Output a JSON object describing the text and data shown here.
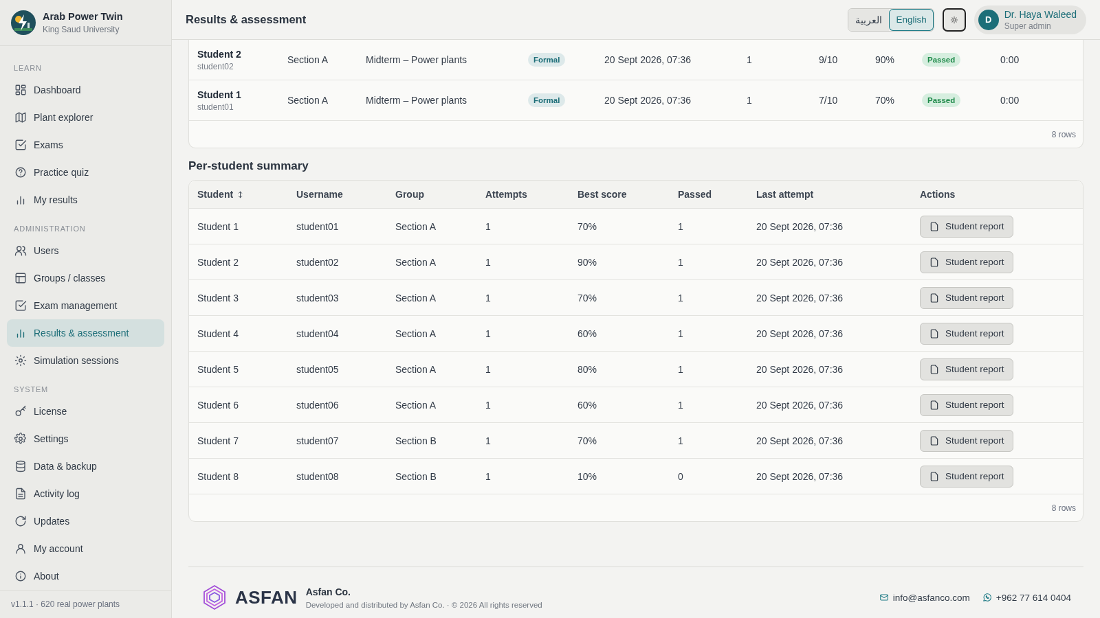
{
  "brand": {
    "title": "Arab Power Twin",
    "subtitle": "King Saud University"
  },
  "sidebar": {
    "sections": [
      {
        "label": "LEARN",
        "items": [
          {
            "label": "Dashboard",
            "selected": false
          },
          {
            "label": "Plant explorer",
            "selected": false
          },
          {
            "label": "Exams",
            "selected": false
          },
          {
            "label": "Practice quiz",
            "selected": false
          },
          {
            "label": "My results",
            "selected": false
          }
        ]
      },
      {
        "label": "ADMINISTRATION",
        "items": [
          {
            "label": "Users",
            "selected": false
          },
          {
            "label": "Groups / classes",
            "selected": false
          },
          {
            "label": "Exam management",
            "selected": false
          },
          {
            "label": "Results & assessment",
            "selected": true
          },
          {
            "label": "Simulation sessions",
            "selected": false
          }
        ]
      },
      {
        "label": "SYSTEM",
        "items": [
          {
            "label": "License",
            "selected": false
          },
          {
            "label": "Settings",
            "selected": false
          },
          {
            "label": "Data & backup",
            "selected": false
          },
          {
            "label": "Activity log",
            "selected": false
          },
          {
            "label": "Updates",
            "selected": false
          },
          {
            "label": "My account",
            "selected": false
          },
          {
            "label": "About",
            "selected": false
          }
        ]
      }
    ],
    "version": "v1.1.1 · 620 real power plants"
  },
  "header": {
    "title": "Results & assessment",
    "languages": [
      {
        "label": "العربية",
        "selected": false
      },
      {
        "label": "English",
        "selected": true
      }
    ],
    "user": {
      "initial": "D",
      "name": "Dr. Haya Waleed",
      "role": "Super admin"
    }
  },
  "attempts_table": {
    "rows": [
      {
        "student": "Student 2",
        "username": "student02",
        "group": "Section A",
        "exam": "Midterm – Power plants",
        "type": "Formal",
        "date": "20 Sept 2026, 07:36",
        "attempt": "1",
        "score": "9/10",
        "percent": "90%",
        "status": "Passed",
        "time": "0:00"
      },
      {
        "student": "Student 1",
        "username": "student01",
        "group": "Section A",
        "exam": "Midterm – Power plants",
        "type": "Formal",
        "date": "20 Sept 2026, 07:36",
        "attempt": "1",
        "score": "7/10",
        "percent": "70%",
        "status": "Passed",
        "time": "0:00"
      }
    ],
    "row_count": "8 rows"
  },
  "summary": {
    "title": "Per-student summary",
    "columns": [
      "Student",
      "Username",
      "Group",
      "Attempts",
      "Best score",
      "Passed",
      "Last attempt",
      "Actions"
    ],
    "rows": [
      {
        "student": "Student 1",
        "username": "student01",
        "group": "Section A",
        "attempts": "1",
        "best": "70%",
        "passed": "1",
        "last": "20 Sept 2026, 07:36",
        "action": "Student report"
      },
      {
        "student": "Student 2",
        "username": "student02",
        "group": "Section A",
        "attempts": "1",
        "best": "90%",
        "passed": "1",
        "last": "20 Sept 2026, 07:36",
        "action": "Student report"
      },
      {
        "student": "Student 3",
        "username": "student03",
        "group": "Section A",
        "attempts": "1",
        "best": "70%",
        "passed": "1",
        "last": "20 Sept 2026, 07:36",
        "action": "Student report"
      },
      {
        "student": "Student 4",
        "username": "student04",
        "group": "Section A",
        "attempts": "1",
        "best": "60%",
        "passed": "1",
        "last": "20 Sept 2026, 07:36",
        "action": "Student report"
      },
      {
        "student": "Student 5",
        "username": "student05",
        "group": "Section A",
        "attempts": "1",
        "best": "80%",
        "passed": "1",
        "last": "20 Sept 2026, 07:36",
        "action": "Student report"
      },
      {
        "student": "Student 6",
        "username": "student06",
        "group": "Section A",
        "attempts": "1",
        "best": "60%",
        "passed": "1",
        "last": "20 Sept 2026, 07:36",
        "action": "Student report"
      },
      {
        "student": "Student 7",
        "username": "student07",
        "group": "Section B",
        "attempts": "1",
        "best": "70%",
        "passed": "1",
        "last": "20 Sept 2026, 07:36",
        "action": "Student report"
      },
      {
        "student": "Student 8",
        "username": "student08",
        "group": "Section B",
        "attempts": "1",
        "best": "10%",
        "passed": "0",
        "last": "20 Sept 2026, 07:36",
        "action": "Student report"
      }
    ],
    "row_count": "8 rows"
  },
  "footer": {
    "logo_text": "ASFAN",
    "company": "Asfan Co.",
    "credit": "Developed and distributed by Asfan Co. · © 2026 All rights reserved",
    "email": "info@asfanco.com",
    "phone": "+962 77 614 0404"
  }
}
